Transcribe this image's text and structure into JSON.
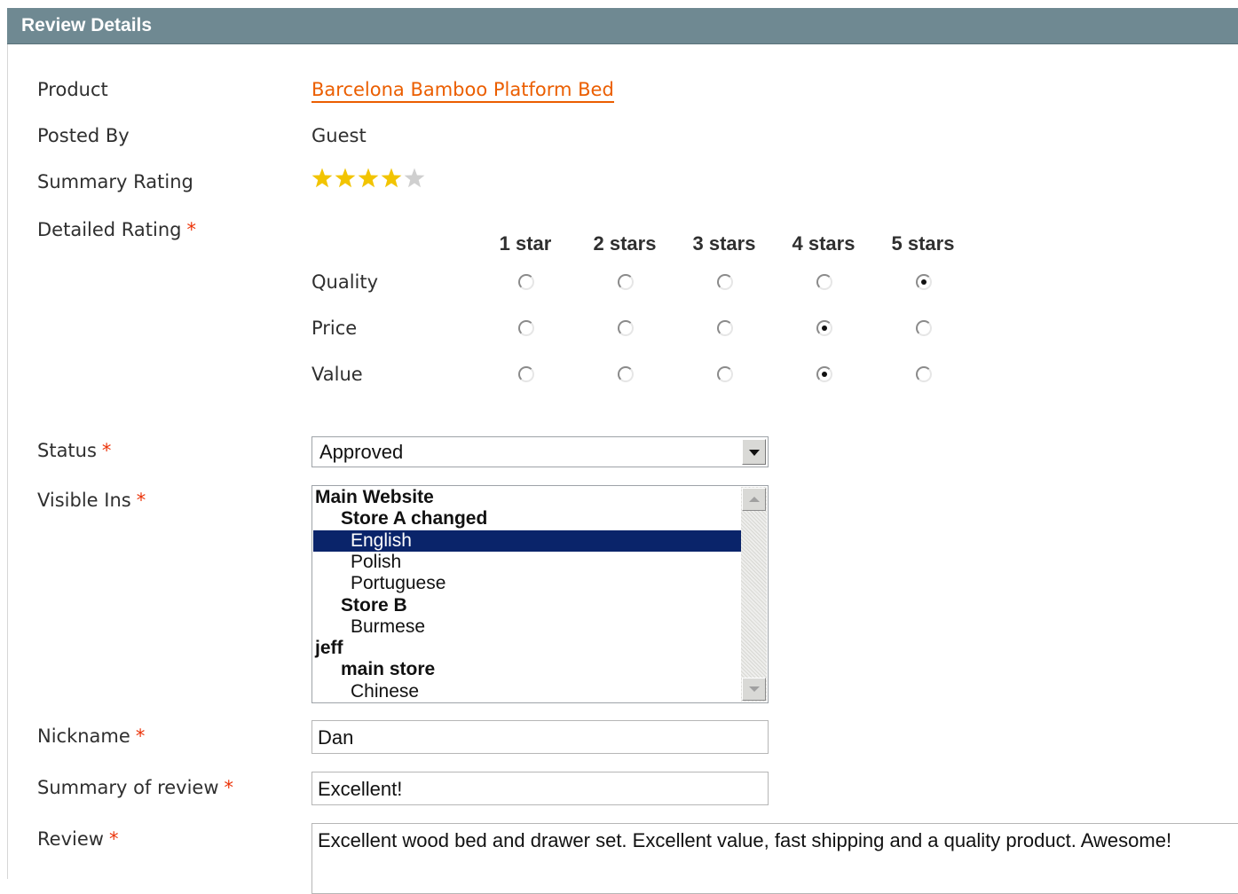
{
  "header": {
    "title": "Review Details"
  },
  "product": {
    "label": "Product",
    "value": "Barcelona Bamboo Platform Bed"
  },
  "posted_by": {
    "label": "Posted By",
    "value": "Guest"
  },
  "summary_rating": {
    "label": "Summary Rating",
    "stars_filled": 4,
    "stars_total": 5,
    "star_color": "#f2c400",
    "empty_color": "#cfcfcf"
  },
  "detailed_rating": {
    "label": "Detailed Rating",
    "columns": [
      "1 star",
      "2 stars",
      "3 stars",
      "4 stars",
      "5 stars"
    ],
    "rows": [
      {
        "label": "Quality",
        "selected": 5
      },
      {
        "label": "Price",
        "selected": 4
      },
      {
        "label": "Value",
        "selected": 4
      }
    ]
  },
  "status": {
    "label": "Status",
    "value": "Approved"
  },
  "visible_in": {
    "label": "Visible Ins",
    "options": [
      {
        "text": "Main Website",
        "level": 0,
        "selected": false
      },
      {
        "text": "Store A changed",
        "level": 1,
        "selected": false
      },
      {
        "text": "English",
        "level": 2,
        "selected": true
      },
      {
        "text": "Polish",
        "level": 2,
        "selected": false
      },
      {
        "text": "Portuguese",
        "level": 2,
        "selected": false
      },
      {
        "text": "Store B",
        "level": 1,
        "selected": false
      },
      {
        "text": "Burmese",
        "level": 2,
        "selected": false
      },
      {
        "text": "jeff",
        "level": 0,
        "selected": false
      },
      {
        "text": "main store",
        "level": 1,
        "selected": false
      },
      {
        "text": "Chinese",
        "level": 2,
        "selected": false
      }
    ]
  },
  "nickname": {
    "label": "Nickname",
    "value": "Dan"
  },
  "summary_of_review": {
    "label": "Summary of review",
    "value": "Excellent!"
  },
  "review": {
    "label": "Review",
    "value": "Excellent wood bed and drawer set. Excellent value, fast shipping and a quality product. Awesome!"
  },
  "required_marker": "*",
  "colors": {
    "header_bg": "#6f8992",
    "link": "#eb5e00",
    "required": "#eb340a",
    "selection": "#0a246a"
  }
}
